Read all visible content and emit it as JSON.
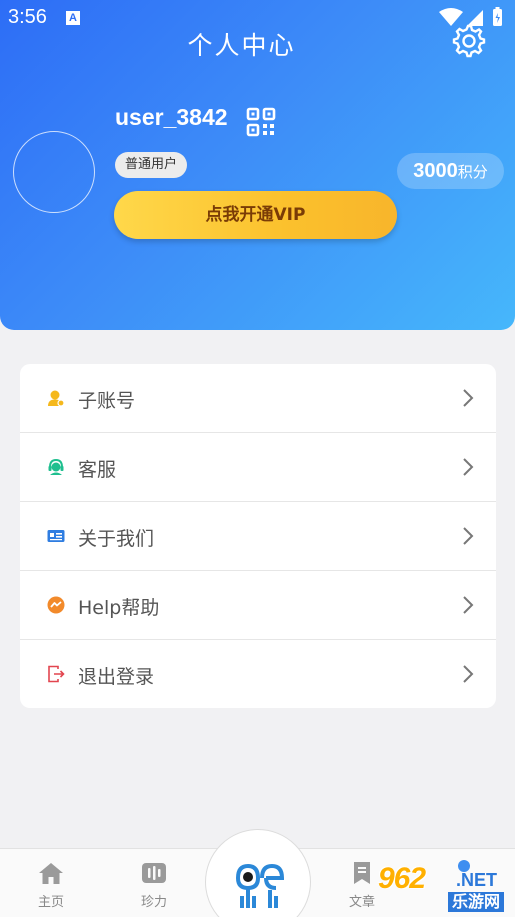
{
  "status_bar": {
    "time": "3:56",
    "notification_letter": "A"
  },
  "header": {
    "title": "个人中心"
  },
  "profile": {
    "username": "user_3842",
    "level_badge": "普通用户",
    "points_value": "3000",
    "points_unit": "积分",
    "vip_button": "点我开通VIP"
  },
  "menu": {
    "items": [
      {
        "label": "子账号",
        "icon": "sub-account-icon",
        "color": "#f5b81c"
      },
      {
        "label": "客服",
        "icon": "customer-service-icon",
        "color": "#1fbf8f"
      },
      {
        "label": "关于我们",
        "icon": "about-card-icon",
        "color": "#2f7de1"
      },
      {
        "label": "Help帮助",
        "icon": "help-chat-icon",
        "color": "#f28a2b"
      },
      {
        "label": "退出登录",
        "icon": "logout-icon",
        "color": "#e2454f"
      }
    ]
  },
  "tabbar": {
    "home": "主页",
    "power": "珍力",
    "articles": "文章"
  },
  "watermark": {
    "number": "962",
    "domain": ".NET",
    "sub": "乐游网"
  },
  "colors": {
    "header_start": "#2d6df6",
    "header_end": "#46b7fb",
    "vip_gold": "#fbc12d"
  }
}
